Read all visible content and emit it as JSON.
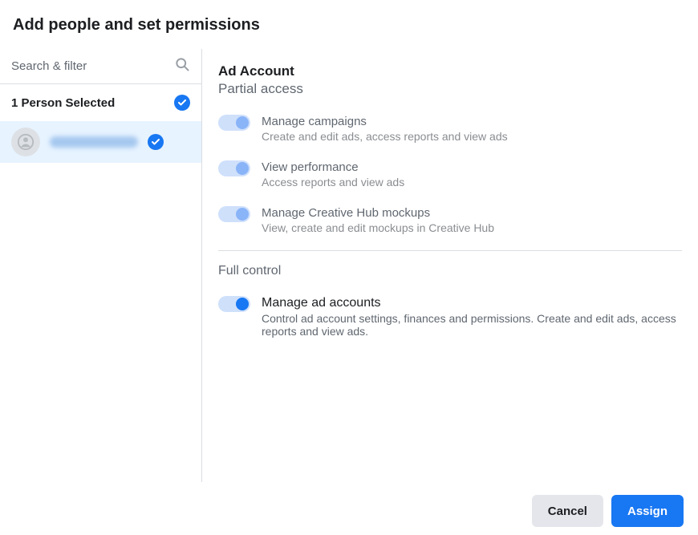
{
  "header": {
    "title": "Add people and set permissions"
  },
  "search": {
    "placeholder": "Search & filter"
  },
  "people": {
    "selected_label": "1 Person Selected"
  },
  "right": {
    "section_title": "Ad Account",
    "partial_label": "Partial access",
    "full_label": "Full control",
    "permissions": {
      "campaigns": {
        "title": "Manage campaigns",
        "desc": "Create and edit ads, access reports and view ads"
      },
      "performance": {
        "title": "View performance",
        "desc": "Access reports and view ads"
      },
      "creative": {
        "title": "Manage Creative Hub mockups",
        "desc": "View, create and edit mockups in Creative Hub"
      },
      "manage_accounts": {
        "title": "Manage ad accounts",
        "desc": "Control ad account settings, finances and permissions. Create and edit ads, access reports and view ads."
      }
    }
  },
  "footer": {
    "cancel": "Cancel",
    "assign": "Assign"
  }
}
